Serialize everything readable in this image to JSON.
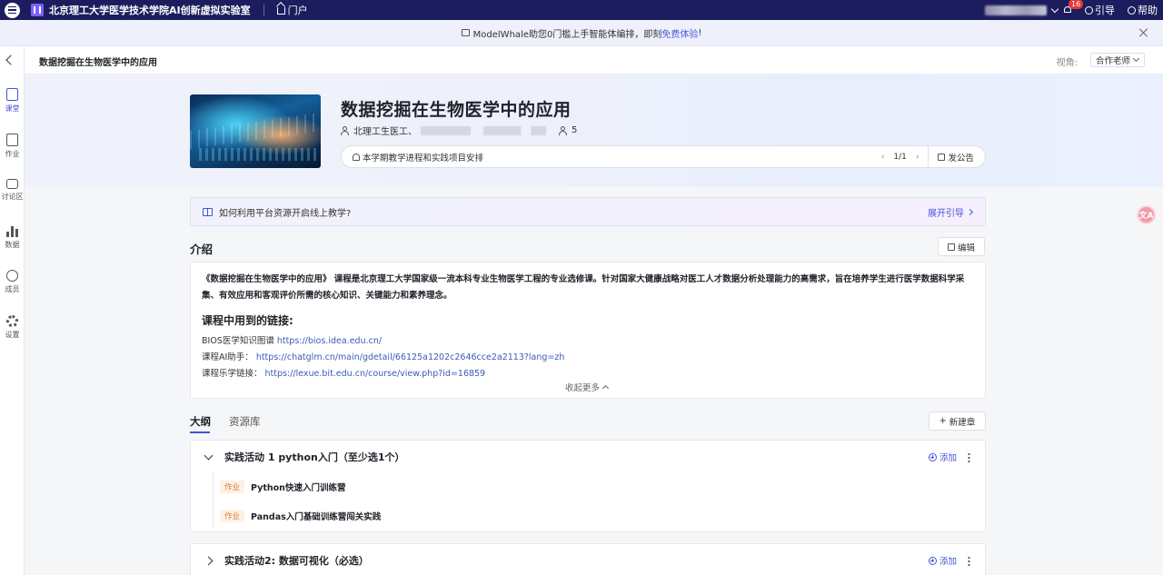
{
  "topbar": {
    "org_name": "北京理工大学医学技术学院AI创新虚拟实验室",
    "portal_label": "门户",
    "badge_count": "16",
    "guide_label": "引导",
    "help_label": "帮助"
  },
  "notice": {
    "text_before": "ModelWhale助您0门槛上手智能体编排，即刻",
    "link": "免费体验",
    "text_after": "!"
  },
  "sidebar": {
    "items": [
      {
        "label": "课堂"
      },
      {
        "label": "作业"
      },
      {
        "label": "讨论区"
      },
      {
        "label": "数据"
      },
      {
        "label": "成员"
      },
      {
        "label": "设置"
      }
    ]
  },
  "page": {
    "breadcrumb_title": "数据挖掘在生物医学中的应用",
    "view_label": "视角:",
    "role_value": "合作老师"
  },
  "hero": {
    "title": "数据挖掘在生物医学中的应用",
    "teacher_prefix": "北理工生医工、",
    "member_count": "5",
    "announcement": "本学期教学进程和实践项目安排",
    "pager": "1/1",
    "post_label": "发公告"
  },
  "guide": {
    "text": "如何利用平台资源开启线上教学?",
    "link": "展开引导"
  },
  "intro": {
    "section_title": "介绍",
    "edit_label": "编辑",
    "paragraph": "《数据挖掘在生物医学中的应用》 课程是北京理工大学国家级一流本科专业生物医学工程的专业选修课。针对国家大健康战略对医工人才数据分析处理能力的高需求，旨在培养学生进行医学数据科学采集、有效应用和客观评价所需的核心知识、关键能力和素养理念。",
    "links_title": "课程中用到的链接:",
    "links": [
      {
        "label": "BIOS医学知识图谱",
        "url": "https://bios.idea.edu.cn/"
      },
      {
        "label": "课程AI助手：",
        "url": "https://chatglm.cn/main/gdetail/66125a1202c2646cce2a2113?lang=zh"
      },
      {
        "label": "课程乐学链接：",
        "url": "https://lexue.bit.edu.cn/course/view.php?id=16859"
      }
    ],
    "collapse_label": "收起更多"
  },
  "tabs": {
    "outline": "大纲",
    "resources": "资源库",
    "new_chapter": "新建章"
  },
  "outline": [
    {
      "title": "实践活动 1 python入门（至少选1个）",
      "add_label": "添加",
      "items": [
        {
          "tag": "作业",
          "title": "Python快速入门训练营"
        },
        {
          "tag": "作业",
          "title": "Pandas入门基础训练营闯关实践"
        }
      ]
    },
    {
      "title": "实践活动2: 数据可视化（必选）",
      "add_label": "添加"
    }
  ],
  "colors": {
    "topbar": "#1c1d5e",
    "accent": "#4453d4",
    "tag": "#e07a2f"
  },
  "float_button": "文A"
}
